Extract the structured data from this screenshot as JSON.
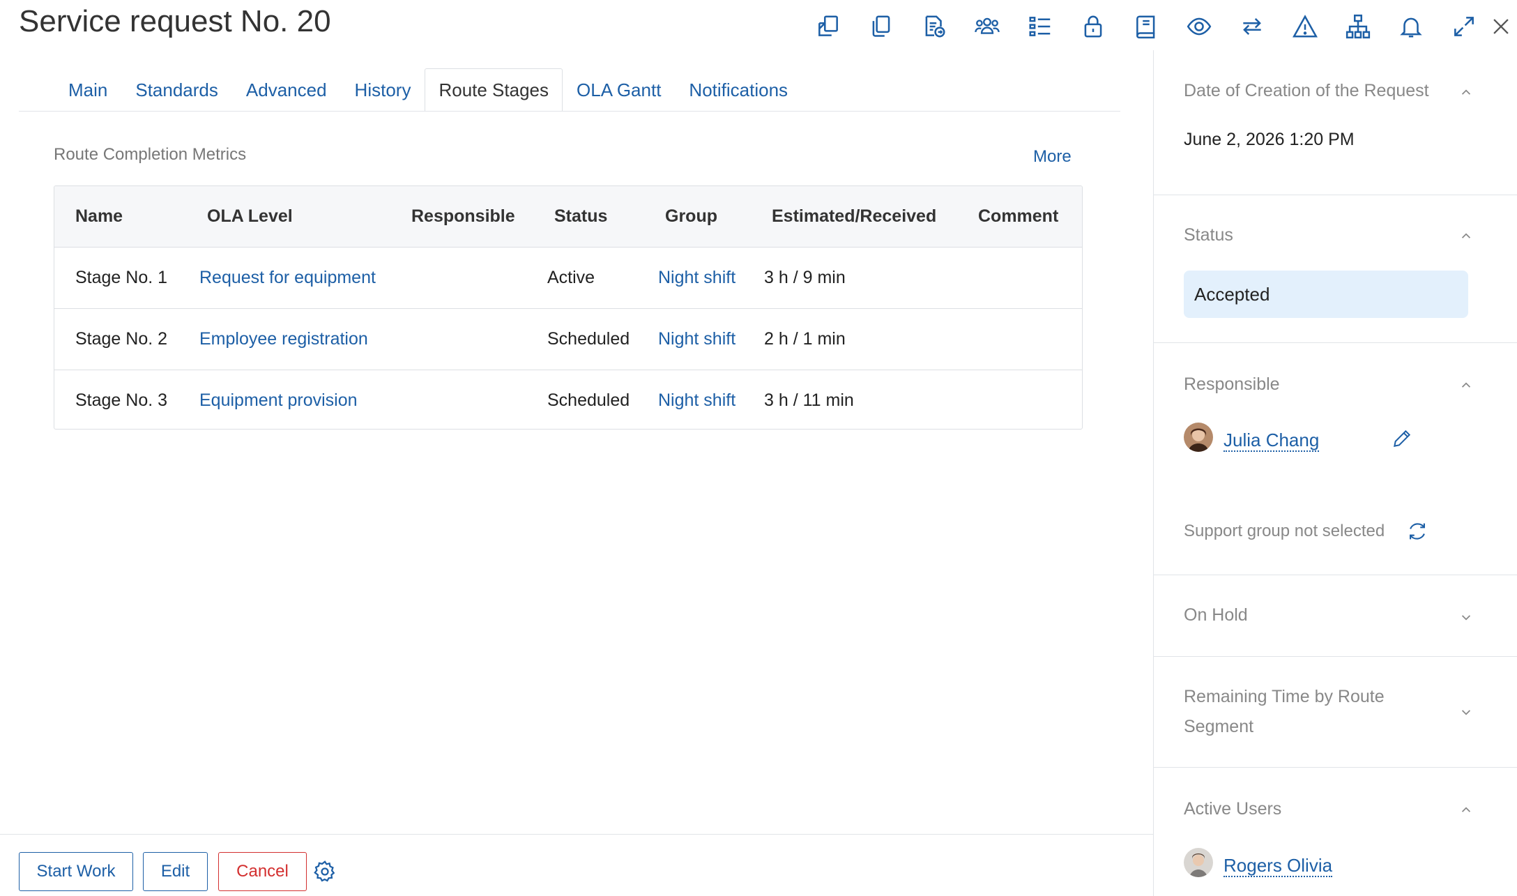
{
  "header": {
    "title": "Service request No. 20",
    "toolbar_icons": [
      "transfer-icon",
      "copy-icon",
      "export-document-icon",
      "group-users-icon",
      "checklist-icon",
      "lock-icon",
      "book-icon",
      "watch-eye-icon",
      "swap-arrows-icon",
      "warning-icon",
      "hierarchy-icon",
      "bell-icon",
      "expand-icon"
    ],
    "close_icon": "close-icon"
  },
  "tabs": [
    {
      "label": "Main",
      "active": false
    },
    {
      "label": "Standards",
      "active": false
    },
    {
      "label": "Advanced",
      "active": false
    },
    {
      "label": "History",
      "active": false
    },
    {
      "label": "Route Stages",
      "active": true
    },
    {
      "label": "OLA Gantt",
      "active": false
    },
    {
      "label": "Notifications",
      "active": false
    }
  ],
  "metrics": {
    "section_title": "Route Completion Metrics",
    "more_label": "More",
    "columns": [
      "Name",
      "OLA Level",
      "Responsible",
      "Status",
      "Group",
      "Estimated/Received",
      "Comment"
    ],
    "rows": [
      {
        "name": "Stage No. 1",
        "ola": "Request for equipment",
        "responsible": "",
        "status": "Active",
        "group": "Night shift",
        "estimated": "3 h / 9 min",
        "comment": ""
      },
      {
        "name": "Stage No. 2",
        "ola": "Employee registration",
        "responsible": "",
        "status": "Scheduled",
        "group": "Night shift",
        "estimated": "2 h / 1 min",
        "comment": ""
      },
      {
        "name": "Stage No. 3",
        "ola": "Equipment provision",
        "responsible": "",
        "status": "Scheduled",
        "group": "Night shift",
        "estimated": "3 h / 11 min",
        "comment": ""
      }
    ]
  },
  "footer": {
    "start_label": "Start Work",
    "edit_label": "Edit",
    "cancel_label": "Cancel"
  },
  "sidebar": {
    "date": {
      "title": "Date of Creation of the Request",
      "value": "June 2, 2026 1:20 PM"
    },
    "status": {
      "title": "Status",
      "value": "Accepted"
    },
    "responsible": {
      "title": "Responsible",
      "user": "Julia Chang",
      "support": "Support group not selected"
    },
    "on_hold": {
      "title": "On Hold"
    },
    "remaining": {
      "title_line1": "Remaining Time by Route",
      "title_line2": "Segment"
    },
    "active_users": {
      "title": "Active Users",
      "user": "Rogers Olivia"
    }
  },
  "colors": {
    "accent": "#1d5fa6",
    "danger": "#d32f2f",
    "status_bg": "#e3f0fc",
    "border": "#dcdfe3"
  }
}
